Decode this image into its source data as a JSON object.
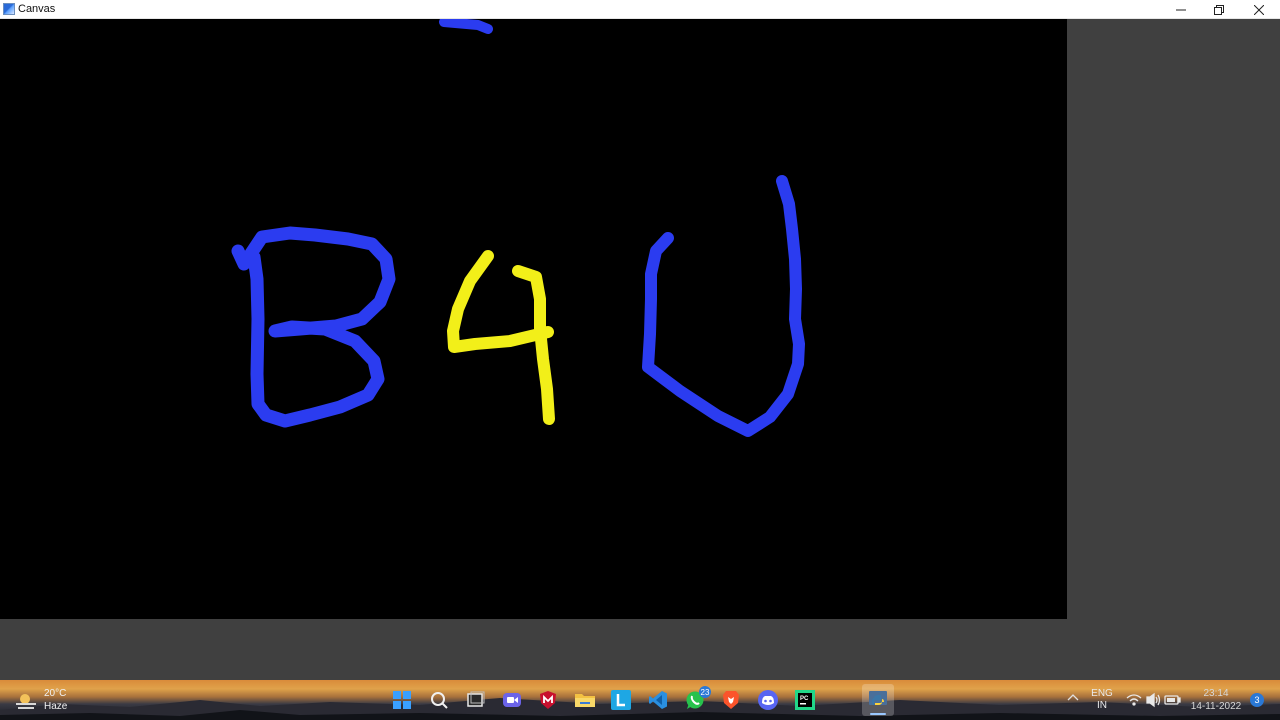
{
  "window": {
    "title": "Canvas",
    "controls": [
      "minimize",
      "restore",
      "close"
    ]
  },
  "canvas": {
    "background": "#000000",
    "stroke_colors": {
      "blue": "#2b3cf0",
      "yellow": "#f2ef19"
    },
    "drawn_strokes": [
      "B",
      "4",
      "U",
      "stray-mark-top"
    ]
  },
  "taskbar": {
    "weather": {
      "temperature": "20°C",
      "condition": "Haze",
      "icon": "haze-sun-icon"
    },
    "pinned_apps": [
      {
        "name": "windows-start",
        "icon": "windows-logo-icon"
      },
      {
        "name": "search",
        "icon": "search-icon"
      },
      {
        "name": "task-view",
        "icon": "task-view-icon"
      },
      {
        "name": "teams-chat",
        "icon": "chat-camera-icon"
      },
      {
        "name": "mcafee",
        "icon": "shield-m-icon"
      },
      {
        "name": "file-explorer",
        "icon": "folder-icon"
      },
      {
        "name": "l-app",
        "icon": "l-letter-icon"
      },
      {
        "name": "vs-code",
        "icon": "vscode-icon"
      },
      {
        "name": "whatsapp",
        "icon": "whatsapp-icon",
        "badge": "23"
      },
      {
        "name": "brave",
        "icon": "brave-lion-icon"
      },
      {
        "name": "discord",
        "icon": "discord-icon"
      },
      {
        "name": "pycharm",
        "icon": "pycharm-icon"
      },
      {
        "name": "python",
        "icon": "python-icon",
        "active": true
      }
    ],
    "tray": {
      "language_line1": "ENG",
      "language_line2": "IN",
      "time": "23:14",
      "date": "14-11-2022",
      "notification_count": "3"
    }
  }
}
